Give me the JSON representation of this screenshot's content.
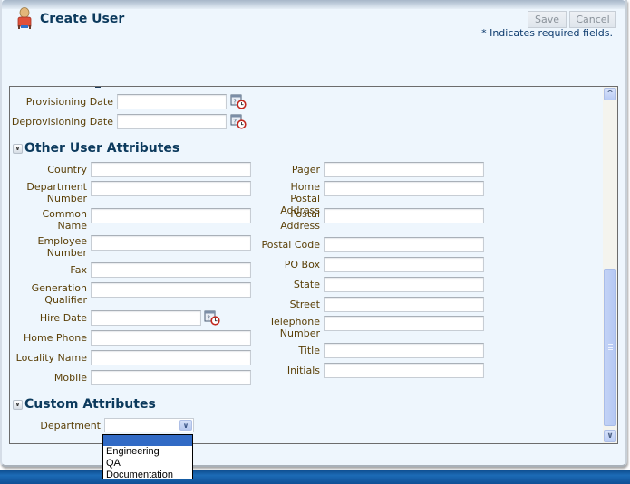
{
  "header": {
    "title": "Create User",
    "icon": "user-icon",
    "save_label": "Save",
    "cancel_label": "Cancel",
    "required_note": "* Indicates required fields."
  },
  "dates": {
    "provisioning_label": "Provisioning Date",
    "provisioning_value": "",
    "deprovisioning_label": "Deprovisioning Date",
    "deprovisioning_value": "",
    "calendar_icon": "calendar-clock-icon"
  },
  "other_attributes": {
    "title": "Other User Attributes",
    "left": [
      {
        "label": "Country",
        "value": ""
      },
      {
        "label": "Department Number",
        "value": ""
      },
      {
        "label": "Common Name",
        "value": ""
      },
      {
        "label": "Employee Number",
        "value": ""
      },
      {
        "label": "Fax",
        "value": ""
      },
      {
        "label": "Generation Qualifier",
        "value": ""
      },
      {
        "label": "Hire Date",
        "value": ""
      },
      {
        "label": "Home Phone",
        "value": ""
      },
      {
        "label": "Locality Name",
        "value": ""
      },
      {
        "label": "Mobile",
        "value": ""
      }
    ],
    "right": [
      {
        "label": "Pager",
        "value": ""
      },
      {
        "label": "Home Postal Address",
        "value": ""
      },
      {
        "label": "Postal Address",
        "value": ""
      },
      {
        "label": "Postal Code",
        "value": ""
      },
      {
        "label": "PO Box",
        "value": ""
      },
      {
        "label": "State",
        "value": ""
      },
      {
        "label": "Street",
        "value": ""
      },
      {
        "label": "Telephone Number",
        "value": ""
      },
      {
        "label": "Title",
        "value": ""
      },
      {
        "label": "Initials",
        "value": ""
      }
    ]
  },
  "custom_attributes": {
    "title": "Custom Attributes",
    "department_label": "Department",
    "department_value": "",
    "options": [
      "",
      "Engineering",
      "QA",
      "Documentation"
    ],
    "highlighted_option": ""
  },
  "colors": {
    "label": "#5a3f06",
    "heading": "#0c3a5d",
    "selection": "#316ac5",
    "background": "#eef6fd"
  }
}
